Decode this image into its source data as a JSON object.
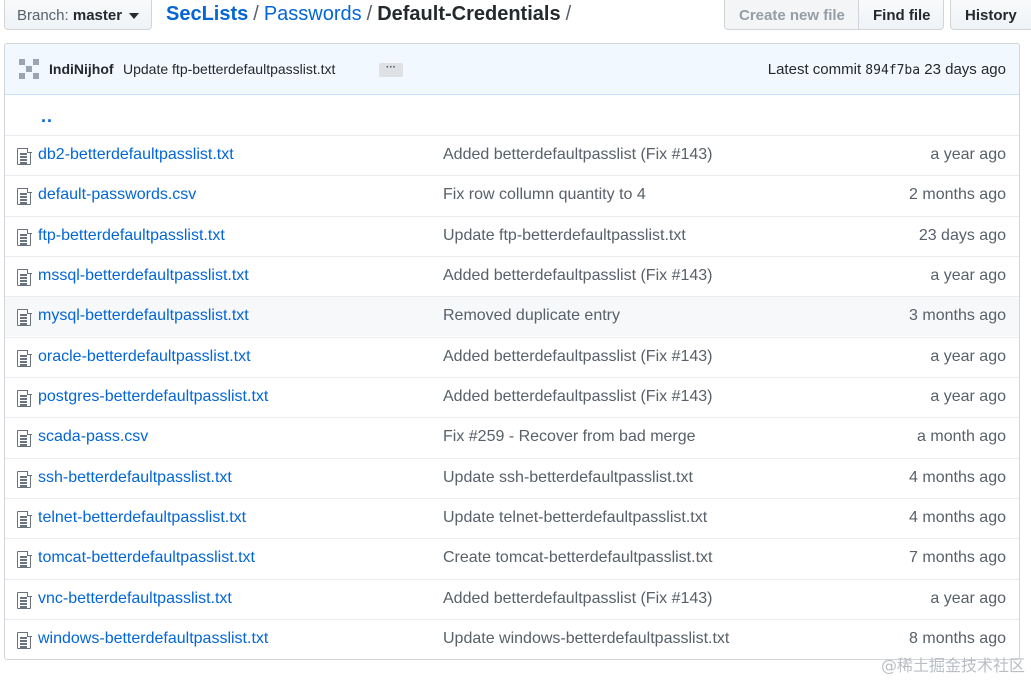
{
  "branch": {
    "label": "Branch:",
    "name": "master"
  },
  "breadcrumb": {
    "repo": "SecLists",
    "folder": "Passwords",
    "current": "Default-Credentials",
    "trailing_sep": "/"
  },
  "actions": {
    "create_new_file": "Create new file",
    "find_file": "Find file",
    "history": "History"
  },
  "commit": {
    "author": "IndiNijhof",
    "message": "Update ftp-betterdefaultpasslist.txt",
    "ellipsis": "···",
    "latest_label": "Latest commit",
    "sha": "894f7ba",
    "age": "23 days ago"
  },
  "parent_dir": "..",
  "files": [
    {
      "name": "db2-betterdefaultpasslist.txt",
      "message": "Added betterdefaultpasslist (Fix #143)",
      "age": "a year ago"
    },
    {
      "name": "default-passwords.csv",
      "message": "Fix row collumn quantity to 4",
      "age": "2 months ago"
    },
    {
      "name": "ftp-betterdefaultpasslist.txt",
      "message": "Update ftp-betterdefaultpasslist.txt",
      "age": "23 days ago"
    },
    {
      "name": "mssql-betterdefaultpasslist.txt",
      "message": "Added betterdefaultpasslist (Fix #143)",
      "age": "a year ago"
    },
    {
      "name": "mysql-betterdefaultpasslist.txt",
      "message": "Removed duplicate entry",
      "age": "3 months ago"
    },
    {
      "name": "oracle-betterdefaultpasslist.txt",
      "message": "Added betterdefaultpasslist (Fix #143)",
      "age": "a year ago"
    },
    {
      "name": "postgres-betterdefaultpasslist.txt",
      "message": "Added betterdefaultpasslist (Fix #143)",
      "age": "a year ago"
    },
    {
      "name": "scada-pass.csv",
      "message": "Fix #259 - Recover from bad merge",
      "age": "a month ago"
    },
    {
      "name": "ssh-betterdefaultpasslist.txt",
      "message": "Update ssh-betterdefaultpasslist.txt",
      "age": "4 months ago"
    },
    {
      "name": "telnet-betterdefaultpasslist.txt",
      "message": "Update telnet-betterdefaultpasslist.txt",
      "age": "4 months ago"
    },
    {
      "name": "tomcat-betterdefaultpasslist.txt",
      "message": "Create tomcat-betterdefaultpasslist.txt",
      "age": "7 months ago"
    },
    {
      "name": "vnc-betterdefaultpasslist.txt",
      "message": "Added betterdefaultpasslist (Fix #143)",
      "age": "a year ago"
    },
    {
      "name": "windows-betterdefaultpasslist.txt",
      "message": "Update windows-betterdefaultpasslist.txt",
      "age": "8 months ago"
    }
  ],
  "watermark": "@稀土掘金技术社区"
}
